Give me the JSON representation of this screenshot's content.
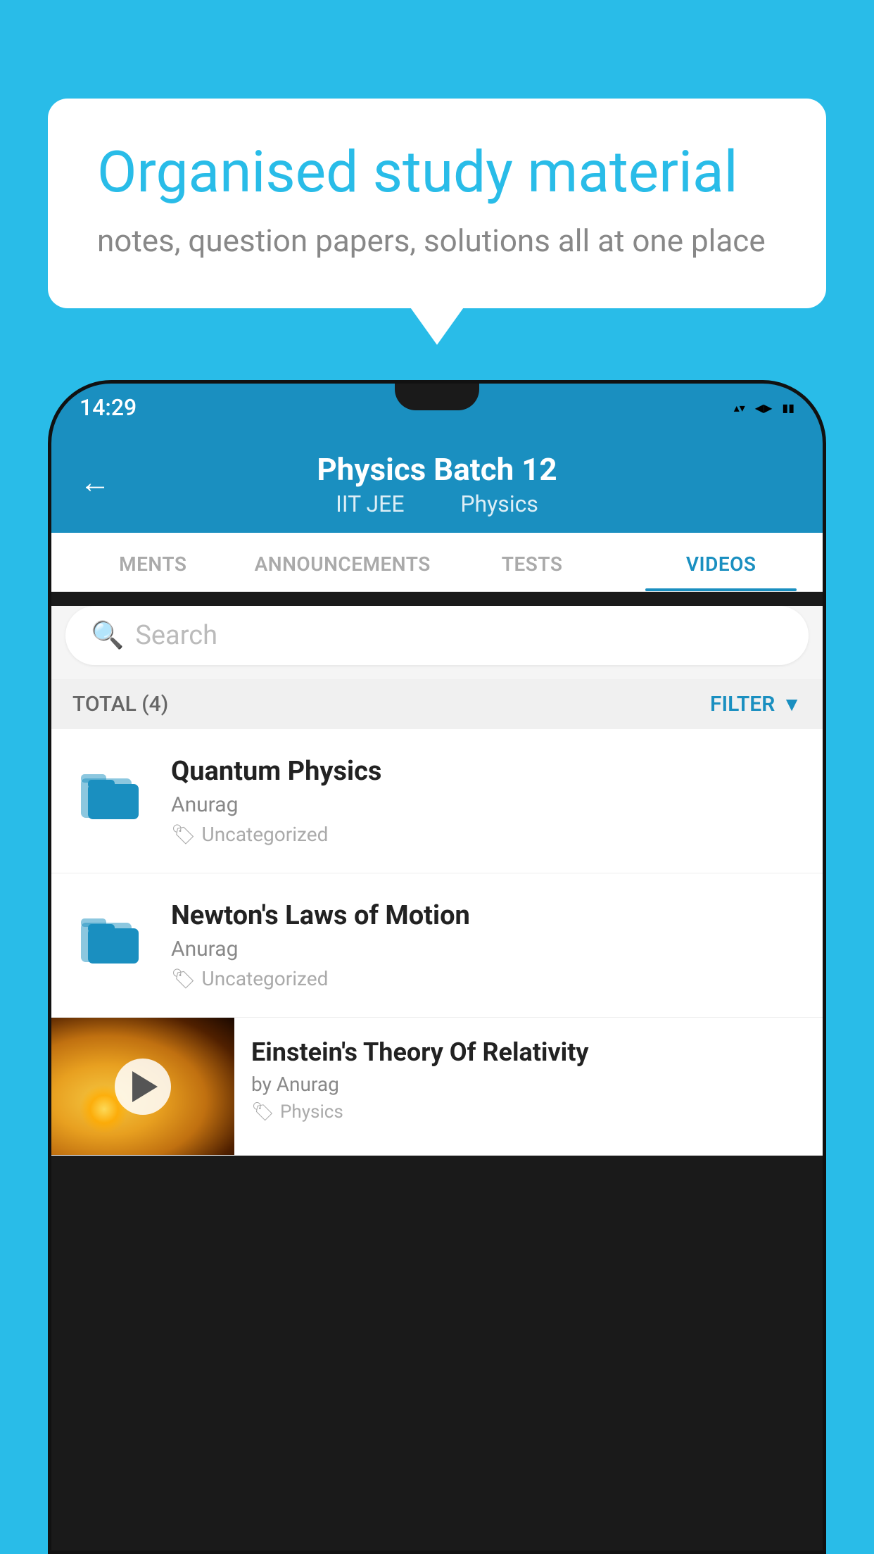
{
  "background_color": "#29bce8",
  "speech_bubble": {
    "title": "Organised study material",
    "subtitle": "notes, question papers, solutions all at one place"
  },
  "status_bar": {
    "time": "14:29",
    "wifi": "▼",
    "signal": "◀",
    "battery": "▮"
  },
  "app_header": {
    "back_label": "←",
    "title": "Physics Batch 12",
    "subtitle_left": "IIT JEE",
    "subtitle_right": "Physics"
  },
  "tabs": [
    {
      "label": "MENTS",
      "active": false
    },
    {
      "label": "ANNOUNCEMENTS",
      "active": false
    },
    {
      "label": "TESTS",
      "active": false
    },
    {
      "label": "VIDEOS",
      "active": true
    }
  ],
  "search": {
    "placeholder": "Search"
  },
  "filter_row": {
    "total_label": "TOTAL (4)",
    "filter_label": "FILTER"
  },
  "videos": [
    {
      "id": 1,
      "title": "Quantum Physics",
      "author": "Anurag",
      "tag": "Uncategorized",
      "type": "folder"
    },
    {
      "id": 2,
      "title": "Newton's Laws of Motion",
      "author": "Anurag",
      "tag": "Uncategorized",
      "type": "folder"
    },
    {
      "id": 3,
      "title": "Einstein's Theory Of Relativity",
      "author": "by Anurag",
      "tag": "Physics",
      "type": "video"
    }
  ]
}
